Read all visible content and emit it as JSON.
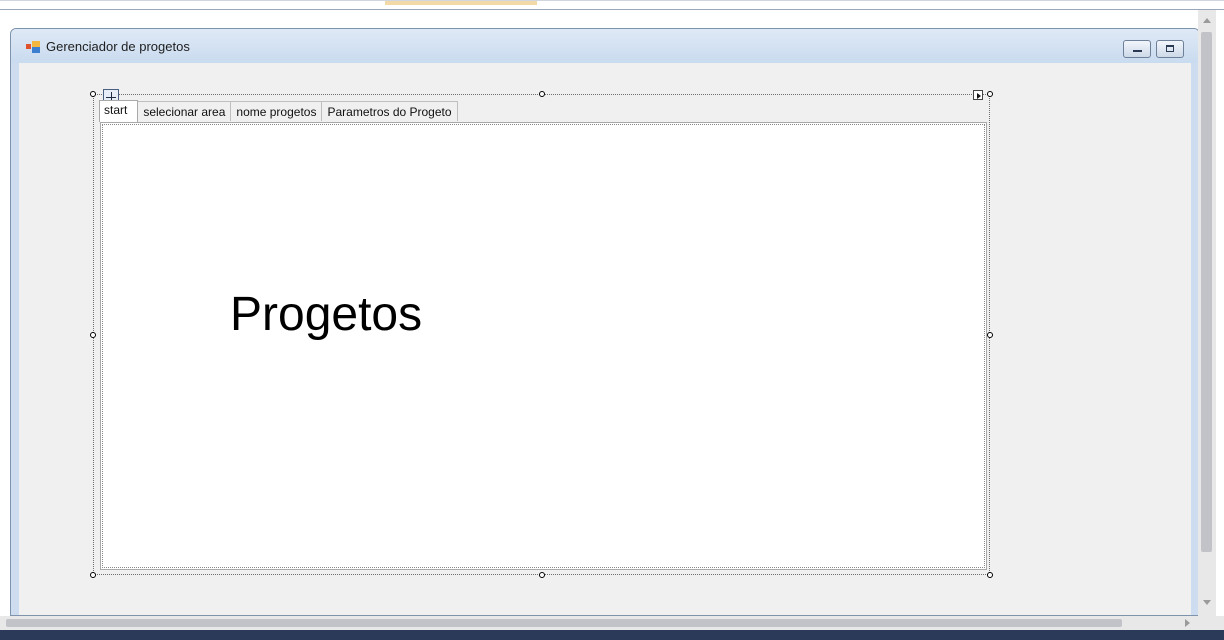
{
  "window": {
    "title": "Gerenciador de progetos",
    "icon": "form-app-icon",
    "buttons": [
      "minimize",
      "maximize"
    ]
  },
  "tab_control": {
    "tabs": [
      {
        "label": "start",
        "selected": true
      },
      {
        "label": "selecionar area",
        "selected": false
      },
      {
        "label": "nome progetos",
        "selected": false
      },
      {
        "label": "Parametros do Progeto",
        "selected": false
      }
    ]
  },
  "tab_page": {
    "label_text": "Progetos"
  },
  "colors": {
    "title_bar": "#c9dbef",
    "client": "#f0f0f0",
    "tab_page": "#ffffff"
  }
}
